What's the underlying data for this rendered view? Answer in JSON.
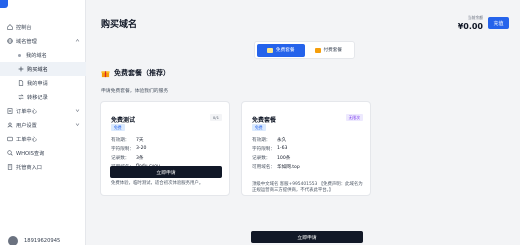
{
  "sidebar": {
    "items": [
      {
        "label": "控制台",
        "icon": "home-icon",
        "level": 0
      },
      {
        "label": "域名管理",
        "icon": "globe-icon",
        "level": 0,
        "chevron": "up"
      },
      {
        "label": "我的域名",
        "level": 1
      },
      {
        "label": "购买域名",
        "level": 1,
        "active": true
      },
      {
        "label": "我的申请",
        "icon": "file-icon",
        "level": 1
      },
      {
        "label": "转移记录",
        "icon": "transfer-icon",
        "level": 1
      },
      {
        "label": "订单中心",
        "icon": "order-icon",
        "level": 0,
        "chevron": "down"
      },
      {
        "label": "用户设置",
        "icon": "user-icon",
        "level": 0,
        "chevron": "down"
      },
      {
        "label": "工单中心",
        "icon": "ticket-icon",
        "level": 0
      },
      {
        "label": "WHOIS查询",
        "icon": "search-icon",
        "level": 0
      },
      {
        "label": "托管商入口",
        "icon": "building-icon",
        "level": 0
      }
    ],
    "user_phone": "18919620945"
  },
  "header": {
    "title": "购买域名",
    "balance_label": "当前余额",
    "balance_value": "¥0.00",
    "recharge_label": "充值"
  },
  "tabs": [
    {
      "label": "免费套餐",
      "active": true
    },
    {
      "label": "付费套餐",
      "active": false
    }
  ],
  "section": {
    "title": "免费套餐（推荐）",
    "desc": "申请免费套餐，体验我们的服务"
  },
  "cards": [
    {
      "title": "免费测试",
      "badge": "免费",
      "tag": "0/1",
      "rows": [
        {
          "k": "有效期：",
          "v": "7天"
        },
        {
          "k": "字符限制：",
          "v": "3-20"
        },
        {
          "k": "记录数：",
          "v": "3条"
        },
        {
          "k": "可用域名：",
          "v": "flodu.cyou"
        }
      ],
      "desc": "免费体验，临时测试，适合初次体验服务用户。",
      "button": "立即申请"
    },
    {
      "title": "免费套餐",
      "badge": "免费",
      "tag": "无限次",
      "rows": [
        {
          "k": "有效期：",
          "v": "永久"
        },
        {
          "k": "字符限制：",
          "v": "1-63"
        },
        {
          "k": "记录数：",
          "v": "100条"
        },
        {
          "k": "可用域名：",
          "v": "华如网.top"
        }
      ],
      "desc": "顶级中文域名 客服+995401553 【免费声明：此域名为正规运营商三方提供商，不代表此平台。】",
      "button": "立即申请"
    }
  ],
  "colors": {
    "primary": "#2563eb",
    "dark_button": "#111827",
    "background": "#f3f4f6"
  }
}
